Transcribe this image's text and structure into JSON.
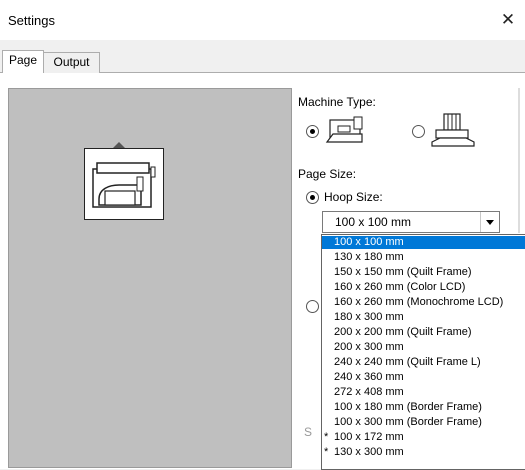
{
  "window": {
    "title": "Settings",
    "close_glyph": "✕"
  },
  "tabs": [
    {
      "label": "Page"
    },
    {
      "label": "Output"
    }
  ],
  "machine_type": {
    "label": "Machine Type:",
    "options": [
      {
        "icon": "embroidery-machine-icon",
        "selected": true
      },
      {
        "icon": "quilting-frame-icon",
        "selected": false
      }
    ]
  },
  "page_size": {
    "label": "Page Size:",
    "hoop_label": "Hoop Size:",
    "hoop_selected": true,
    "combo_value": "100 x 100 mm",
    "options": [
      {
        "text": "100 x 100 mm",
        "selected": true,
        "mark": ""
      },
      {
        "text": "130 x 180 mm",
        "selected": false,
        "mark": ""
      },
      {
        "text": "150 x 150 mm (Quilt Frame)",
        "selected": false,
        "mark": ""
      },
      {
        "text": "160 x 260 mm (Color LCD)",
        "selected": false,
        "mark": ""
      },
      {
        "text": "160 x 260 mm (Monochrome LCD)",
        "selected": false,
        "mark": ""
      },
      {
        "text": "180 x 300 mm",
        "selected": false,
        "mark": ""
      },
      {
        "text": "200 x 200 mm (Quilt Frame)",
        "selected": false,
        "mark": ""
      },
      {
        "text": "200 x 300 mm",
        "selected": false,
        "mark": ""
      },
      {
        "text": "240 x 240 mm (Quilt Frame L)",
        "selected": false,
        "mark": ""
      },
      {
        "text": "240 x 360 mm",
        "selected": false,
        "mark": ""
      },
      {
        "text": "272 x 408 mm",
        "selected": false,
        "mark": ""
      },
      {
        "text": "100 x 180 mm (Border Frame)",
        "selected": false,
        "mark": ""
      },
      {
        "text": "100 x 300 mm (Border Frame)",
        "selected": false,
        "mark": ""
      },
      {
        "text": "100 x 172 mm",
        "selected": false,
        "mark": "*"
      },
      {
        "text": "130 x 300 mm",
        "selected": false,
        "mark": "*"
      }
    ]
  },
  "colors": {
    "selection": "#0078d7",
    "preview_bg": "#bfbfbf"
  }
}
